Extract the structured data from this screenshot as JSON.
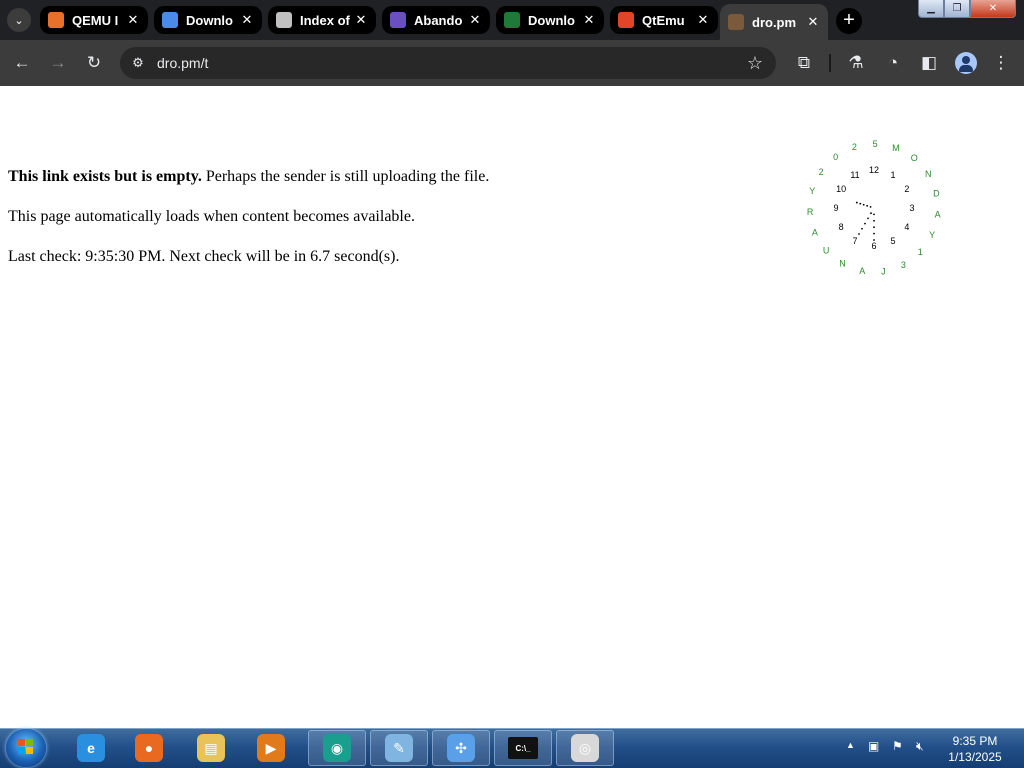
{
  "window": {
    "minimize_glyph": "▁",
    "maximize_glyph": "❐",
    "close_glyph": "✕"
  },
  "tabs": [
    {
      "title": "QEMU I",
      "icon": "qemu-icon",
      "color": "#e8702a",
      "active": false
    },
    {
      "title": "Downlo",
      "icon": "download-site-icon",
      "color": "#4a8be8",
      "active": false
    },
    {
      "title": "Index of",
      "icon": "index-icon",
      "color": "#c0c0c0",
      "active": false
    },
    {
      "title": "Abando",
      "icon": "abandon-icon",
      "color": "#6a4fc0",
      "active": false
    },
    {
      "title": "Downlo",
      "icon": "roms-icon",
      "color": "#1f7a3a",
      "active": false
    },
    {
      "title": "QtEmu",
      "icon": "gitlab-icon",
      "color": "#e24329",
      "active": false
    },
    {
      "title": "dro.pm",
      "icon": "dropm-icon",
      "color": "#7a5a3a",
      "active": true
    }
  ],
  "new_tab_glyph": "+",
  "address_bar": {
    "url": "dro.pm/t"
  },
  "toolbar_icons": [
    "back-icon",
    "forward-icon",
    "reload-icon",
    "site-settings-icon",
    "bookmark-star-icon",
    "extensions-icon",
    "labs-icon",
    "performance-icon",
    "side-panel-icon",
    "profile-icon",
    "menu-icon"
  ],
  "page": {
    "line1_bold": "This link exists but is empty.",
    "line1_rest": " Perhaps the sender is still uploading the file.",
    "line2": "This page automatically loads when content becomes available.",
    "line3": "Last check: 9:35:30 PM. Next check will be in 6.7 second(s)."
  },
  "clock": {
    "hour_numbers": [
      "12",
      "1",
      "2",
      "3",
      "4",
      "5",
      "6",
      "7",
      "8",
      "9",
      "10",
      "11"
    ],
    "outer_letters": [
      "M",
      "O",
      "N",
      "D",
      "A",
      "Y",
      "1",
      "3",
      "J",
      "A",
      "N",
      "U",
      "A",
      "R",
      "Y",
      "2",
      "0",
      "2",
      "5"
    ],
    "number_color": "#000000",
    "letter_color": "#2e8b2e",
    "hand_color": "#000000",
    "time": "9:35:30"
  },
  "taskbar": {
    "apps": [
      {
        "name": "internet-explorer",
        "glyph": "e",
        "color": "#2b8fe0"
      },
      {
        "name": "firefox",
        "glyph": "●",
        "color": "#e8691f"
      },
      {
        "name": "file-explorer",
        "glyph": "▤",
        "color": "#e8c35a"
      },
      {
        "name": "media-player",
        "glyph": "▶",
        "color": "#e07a1a"
      },
      {
        "name": "chrome-app",
        "glyph": "◉",
        "color": "#1a9e8e"
      },
      {
        "name": "notepad-app",
        "glyph": "✎",
        "color": "#7fb5e0"
      },
      {
        "name": "network-app",
        "glyph": "✣",
        "color": "#5aa0e8"
      },
      {
        "name": "command-prompt",
        "glyph": "C:\\_",
        "color": "#111111"
      },
      {
        "name": "document-app",
        "glyph": "◎",
        "color": "#d8d8d8"
      }
    ],
    "tray_arrow": "▲",
    "time": "9:35 PM",
    "date": "1/13/2025"
  }
}
